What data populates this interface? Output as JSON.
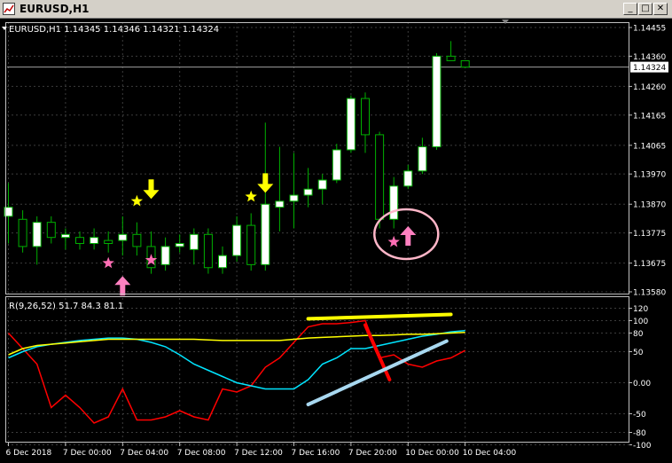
{
  "window": {
    "title": "EURUSD,H1",
    "buttons": {
      "minimize": "_",
      "maximize": "□",
      "close": "✕"
    }
  },
  "colors": {
    "background": "#000000",
    "grid": "#3c3c3c",
    "frame": "#c0c0c0",
    "text": "#ffffff",
    "bull_fill": "#ffffff",
    "bear_fill": "#000000",
    "candle_outline": "#00b000",
    "star_yellow": "#ffff00",
    "star_pink": "#ff6eb4",
    "arrow_yellow": "#ffff00",
    "arrow_pink": "#ff80c0",
    "rsi_red": "#ff0000",
    "rsi_cyan": "#00e5ff",
    "rsi_yellow": "#ffff00",
    "ann_yellow": "#ffff00",
    "ann_red": "#ff0000",
    "ann_blue": "#a8d8f0",
    "ann_circle": "#ffb6c8",
    "price_box_fill": "#ffffff",
    "price_box_text": "#000000"
  },
  "chart_data": [
    {
      "type": "candlestick",
      "symbol_label": "EURUSD,H1  1.14345 1.14346 1.14321 1.14324",
      "current_price": 1.14324,
      "current_price_label": "1.14324",
      "ylim": [
        1.1358,
        1.14455
      ],
      "y_ticks": [
        "1.14455",
        "1.14360",
        "1.14260",
        "1.14165",
        "1.14065",
        "1.13970",
        "1.13870",
        "1.13775",
        "1.13675",
        "1.13580"
      ],
      "x_ticks": [
        {
          "label": "6 Dec 2018",
          "index": 0
        },
        {
          "label": "7 Dec 00:00",
          "index": 4
        },
        {
          "label": "7 Dec 04:00",
          "index": 8
        },
        {
          "label": "7 Dec 08:00",
          "index": 12
        },
        {
          "label": "7 Dec 12:00",
          "index": 16
        },
        {
          "label": "7 Dec 16:00",
          "index": 20
        },
        {
          "label": "7 Dec 20:00",
          "index": 24
        },
        {
          "label": "10 Dec 00:00",
          "index": 28
        },
        {
          "label": "10 Dec 04:00",
          "index": 32
        }
      ],
      "candles": [
        {
          "o": 1.1383,
          "h": 1.1394,
          "l": 1.1374,
          "c": 1.1386
        },
        {
          "o": 1.1382,
          "h": 1.1385,
          "l": 1.1371,
          "c": 1.1373
        },
        {
          "o": 1.1373,
          "h": 1.1383,
          "l": 1.1367,
          "c": 1.1381
        },
        {
          "o": 1.1381,
          "h": 1.1383,
          "l": 1.1374,
          "c": 1.1376
        },
        {
          "o": 1.1376,
          "h": 1.1379,
          "l": 1.1372,
          "c": 1.1377
        },
        {
          "o": 1.1376,
          "h": 1.1378,
          "l": 1.1372,
          "c": 1.1374
        },
        {
          "o": 1.1374,
          "h": 1.1379,
          "l": 1.1372,
          "c": 1.1376
        },
        {
          "o": 1.1375,
          "h": 1.1378,
          "l": 1.1371,
          "c": 1.1374
        },
        {
          "o": 1.1375,
          "h": 1.1383,
          "l": 1.137,
          "c": 1.1377
        },
        {
          "o": 1.1377,
          "h": 1.1381,
          "l": 1.137,
          "c": 1.1373
        },
        {
          "o": 1.1373,
          "h": 1.1378,
          "l": 1.1364,
          "c": 1.1366
        },
        {
          "o": 1.1367,
          "h": 1.1376,
          "l": 1.1365,
          "c": 1.1373
        },
        {
          "o": 1.1373,
          "h": 1.1377,
          "l": 1.1371,
          "c": 1.1374
        },
        {
          "o": 1.1372,
          "h": 1.1379,
          "l": 1.1367,
          "c": 1.1377
        },
        {
          "o": 1.1377,
          "h": 1.1379,
          "l": 1.1364,
          "c": 1.1366
        },
        {
          "o": 1.1366,
          "h": 1.1373,
          "l": 1.1364,
          "c": 1.137
        },
        {
          "o": 1.137,
          "h": 1.1383,
          "l": 1.1368,
          "c": 1.138
        },
        {
          "o": 1.138,
          "h": 1.1384,
          "l": 1.1365,
          "c": 1.1367
        },
        {
          "o": 1.1367,
          "h": 1.1414,
          "l": 1.1365,
          "c": 1.1387
        },
        {
          "o": 1.1386,
          "h": 1.1406,
          "l": 1.1378,
          "c": 1.1388
        },
        {
          "o": 1.1388,
          "h": 1.1404,
          "l": 1.1379,
          "c": 1.139
        },
        {
          "o": 1.139,
          "h": 1.1399,
          "l": 1.1386,
          "c": 1.1392
        },
        {
          "o": 1.1392,
          "h": 1.1397,
          "l": 1.1387,
          "c": 1.1395
        },
        {
          "o": 1.1395,
          "h": 1.1407,
          "l": 1.1394,
          "c": 1.1405
        },
        {
          "o": 1.1405,
          "h": 1.1423,
          "l": 1.1404,
          "c": 1.1422
        },
        {
          "o": 1.1422,
          "h": 1.1424,
          "l": 1.1404,
          "c": 1.141
        },
        {
          "o": 1.141,
          "h": 1.1411,
          "l": 1.1379,
          "c": 1.1382
        },
        {
          "o": 1.1382,
          "h": 1.1396,
          "l": 1.1379,
          "c": 1.1393
        },
        {
          "o": 1.1393,
          "h": 1.14,
          "l": 1.1392,
          "c": 1.1398
        },
        {
          "o": 1.1398,
          "h": 1.1409,
          "l": 1.1397,
          "c": 1.1406
        },
        {
          "o": 1.1406,
          "h": 1.1437,
          "l": 1.1405,
          "c": 1.1436
        },
        {
          "o": 1.1436,
          "h": 1.1441,
          "l": 1.1435,
          "c": 1.14345
        },
        {
          "o": 1.14345,
          "h": 1.14346,
          "l": 1.14321,
          "c": 1.14324
        }
      ],
      "markers": [
        {
          "kind": "star",
          "color": "star_yellow",
          "index": 9,
          "price": 1.1388
        },
        {
          "kind": "arrow-down",
          "color": "arrow_yellow",
          "index": 10,
          "price": 1.1392
        },
        {
          "kind": "star",
          "color": "star_pink",
          "index": 7,
          "price": 1.13675
        },
        {
          "kind": "arrow-up",
          "color": "arrow_pink",
          "index": 8,
          "price": 1.136
        },
        {
          "kind": "star",
          "color": "star_pink",
          "index": 10,
          "price": 1.13685
        },
        {
          "kind": "star",
          "color": "star_yellow",
          "index": 17,
          "price": 1.13895
        },
        {
          "kind": "arrow-down",
          "color": "arrow_yellow",
          "index": 18,
          "price": 1.1394
        },
        {
          "kind": "star",
          "color": "star_pink",
          "index": 27,
          "price": 1.13745
        },
        {
          "kind": "arrow-up",
          "color": "arrow_pink",
          "index": 28,
          "price": 1.13765
        }
      ]
    },
    {
      "type": "line",
      "label": "R(9,26,52) 51.7 84.3 81.1",
      "ylim": [
        -85,
        125
      ],
      "y_ticks": [
        "120",
        "100",
        "80",
        "50",
        "0.00",
        "-50",
        "-80",
        "-100"
      ],
      "series": [
        {
          "color": "rsi_red",
          "values": [
            80,
            55,
            30,
            -40,
            -20,
            -40,
            -65,
            -55,
            -10,
            -60,
            -60,
            -55,
            -45,
            -55,
            -60,
            -10,
            -15,
            -5,
            25,
            40,
            65,
            90,
            95,
            95,
            97,
            100,
            40,
            45,
            30,
            25,
            35,
            40,
            52
          ]
        },
        {
          "color": "rsi_cyan",
          "values": [
            40,
            50,
            58,
            62,
            65,
            68,
            70,
            72,
            72,
            70,
            65,
            58,
            45,
            30,
            20,
            10,
            0,
            -5,
            -10,
            -10,
            -10,
            5,
            30,
            40,
            55,
            55,
            60,
            65,
            70,
            75,
            78,
            82,
            84
          ]
        },
        {
          "color": "rsi_yellow",
          "values": [
            45,
            55,
            60,
            62,
            64,
            66,
            68,
            70,
            70,
            70,
            70,
            70,
            70,
            70,
            69,
            68,
            68,
            68,
            68,
            68,
            70,
            72,
            73,
            74,
            75,
            76,
            76,
            77,
            78,
            78,
            79,
            80,
            81
          ]
        }
      ],
      "annotations": [
        {
          "color": "ann_yellow",
          "from": [
            21,
            103
          ],
          "to": [
            31,
            110
          ]
        },
        {
          "color": "ann_red",
          "from": [
            25,
            93
          ],
          "to": [
            26.7,
            5
          ]
        },
        {
          "color": "ann_blue",
          "from": [
            21,
            -35
          ],
          "to": [
            30.7,
            67
          ]
        }
      ]
    }
  ]
}
